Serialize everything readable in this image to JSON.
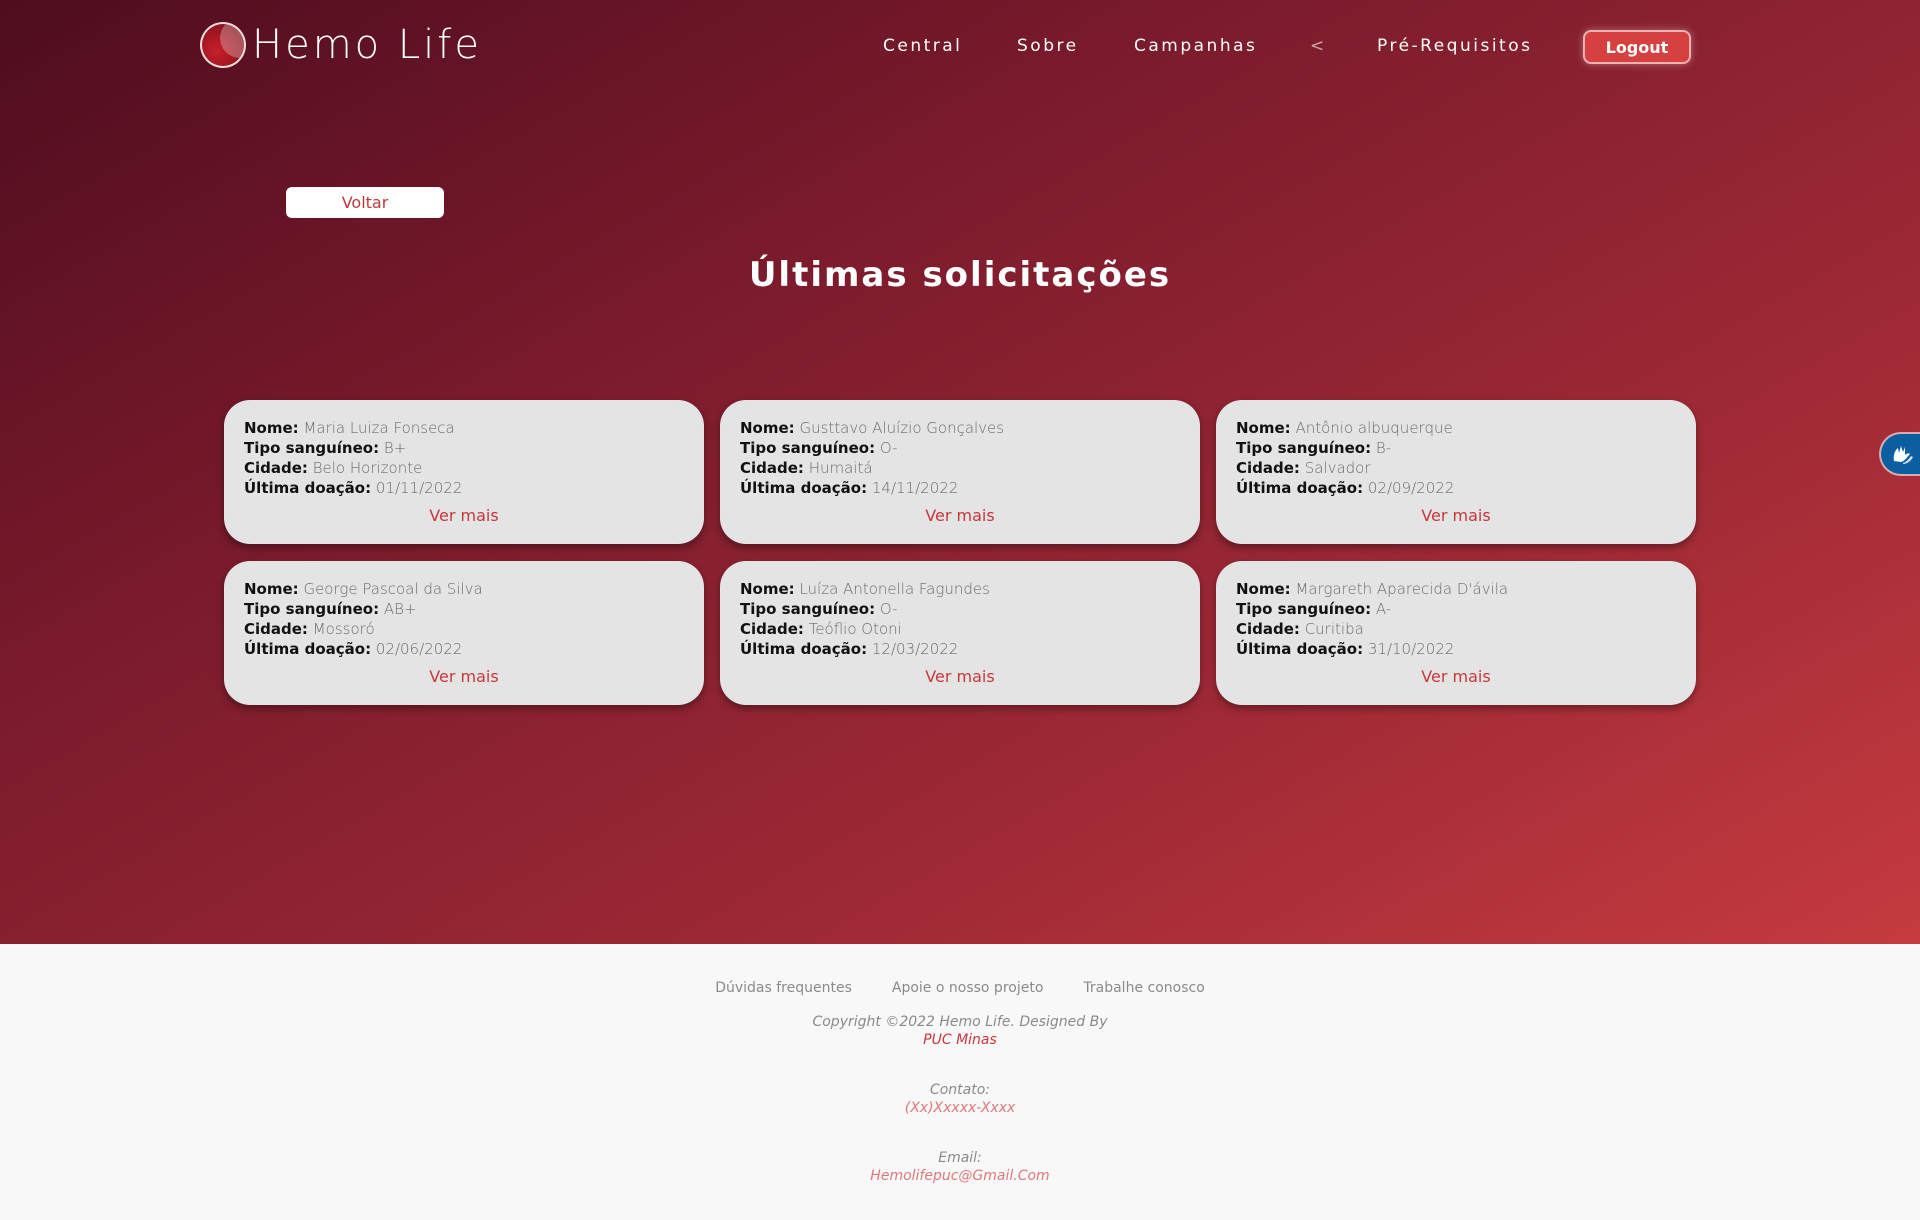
{
  "brand": {
    "name": "Hemo Life"
  },
  "nav": {
    "items": [
      "Central",
      "Sobre",
      "Campanhas",
      "<",
      "Pré-Requisitos"
    ],
    "logout_label": "Logout"
  },
  "back_label": "Voltar",
  "title": "Últimas solicitações",
  "labels": {
    "name": "Nome:",
    "blood_type": "Tipo sanguíneo:",
    "city": "Cidade:",
    "last_donation": "Última doação:",
    "more": "Ver mais"
  },
  "cards": [
    {
      "name": "Maria Luiza Fonseca",
      "blood_type": "B+",
      "city": "Belo Horizonte",
      "last_donation": "01/11/2022"
    },
    {
      "name": "Gusttavo Aluízio Gonçalves",
      "blood_type": "O-",
      "city": "Humaitá",
      "last_donation": "14/11/2022"
    },
    {
      "name": "Antônio albuquerque",
      "blood_type": "B-",
      "city": "Salvador",
      "last_donation": "02/09/2022"
    },
    {
      "name": "George Pascoal da Silva",
      "blood_type": "AB+",
      "city": "Mossoró",
      "last_donation": "02/06/2022"
    },
    {
      "name": "Luíza Antonella Fagundes",
      "blood_type": "O-",
      "city": "Teóflio Otoni",
      "last_donation": "12/03/2022"
    },
    {
      "name": "Margareth Aparecida D'ávila",
      "blood_type": "A-",
      "city": "Curitiba",
      "last_donation": "31/10/2022"
    }
  ],
  "footer": {
    "links": [
      "Dúvidas frequentes",
      "Apoie o nosso projeto",
      "Trabalhe conosco"
    ],
    "copyright": "Copyright ©2022 Hemo Life. Designed By",
    "designer": "PUC Minas",
    "contact_label": "Contato:",
    "contact_value": "(Xx)Xxxxx-Xxxx",
    "email_label": "Email:",
    "email_value": "Hemolifepuc@Gmail.Com"
  },
  "colors": {
    "accent": "#c9363a",
    "hero_start": "#4e0d1e",
    "hero_end": "#c53b3f",
    "card_bg": "#e4e4e4",
    "a11y_widget": "#0b5fa0"
  },
  "icons": {
    "logo": "blood-drop-globe-icon",
    "accessibility": "sign-language-hands-icon"
  }
}
